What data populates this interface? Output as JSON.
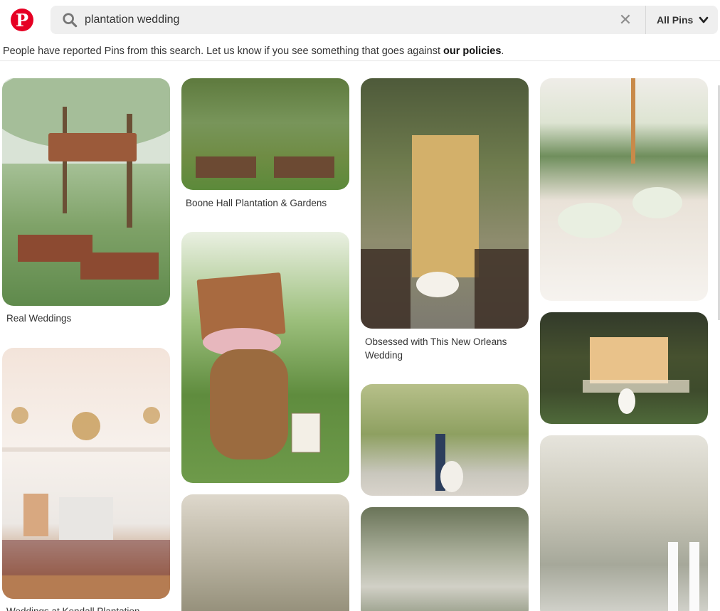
{
  "header": {
    "logo_icon": "pinterest-logo",
    "logo_letter": "P",
    "search_value": "plantation wedding",
    "search_icon": "search-icon",
    "clear_icon": "close-icon",
    "clear_glyph": "✕",
    "scope_label": "All Pins",
    "scope_icon": "chevron-down-icon"
  },
  "notice": {
    "text": "People have reported Pins from this search. Let us know if you see something that goes against ",
    "link": "our policies",
    "end": "."
  },
  "colors": {
    "brand": "#e60023",
    "search_bg": "#efefef"
  },
  "pins": [
    {
      "caption": "Real Weddings"
    },
    {
      "caption": "Weddings at Kendall Plantation"
    },
    {
      "caption": "Boone Hall Plantation & Gardens"
    },
    {
      "caption": ""
    },
    {
      "caption": ""
    },
    {
      "caption": "Obsessed with This New Orleans Wedding"
    },
    {
      "caption": ""
    },
    {
      "caption": ""
    },
    {
      "caption": ""
    },
    {
      "caption": ""
    },
    {
      "caption": ""
    }
  ]
}
